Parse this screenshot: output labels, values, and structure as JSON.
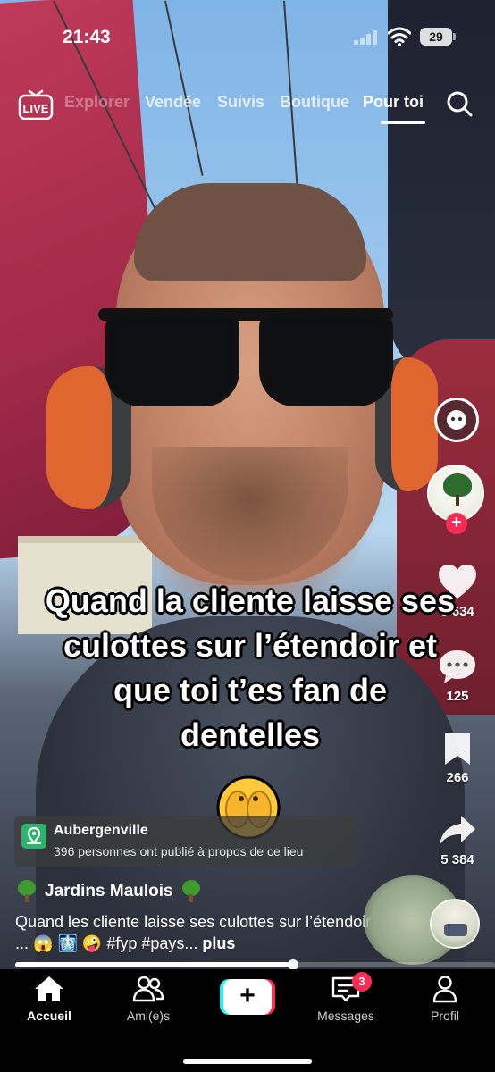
{
  "status_bar": {
    "time": "21:43",
    "battery": "29"
  },
  "top_nav": {
    "live_label": "LIVE",
    "tabs": [
      {
        "label": "Explorer"
      },
      {
        "label": "Vendée"
      },
      {
        "label": "Suivis"
      },
      {
        "label": "Boutique"
      },
      {
        "label": "Pour toi"
      }
    ],
    "active_tab": "Pour toi"
  },
  "video": {
    "caption_lines": [
      "Quand la cliente laisse ses",
      "culottes sur l’étendoir et",
      "que toi t’es fan de",
      "dentelles"
    ]
  },
  "actions": {
    "likes": "8 634",
    "comments": "125",
    "saves": "266",
    "shares": "5 384"
  },
  "location": {
    "title": "Aubergenville",
    "subtitle": "396 personnes ont publié à propos de ce lieu"
  },
  "post": {
    "author": "Jardins Maulois",
    "description": "Quand les cliente laisse ses culottes sur l’étendoir ...",
    "hashtags": "#fyp #pays...",
    "more": "plus"
  },
  "playback": {
    "progress": 0.58
  },
  "bottom_nav": {
    "home": "Accueil",
    "friends": "Ami(e)s",
    "create": "+",
    "messages": "Messages",
    "messages_badge": "3",
    "profile": "Profil"
  },
  "colors": {
    "accent_red": "#fe2c55",
    "accent_cyan": "#25f4ee",
    "location_green": "#2db36e"
  }
}
